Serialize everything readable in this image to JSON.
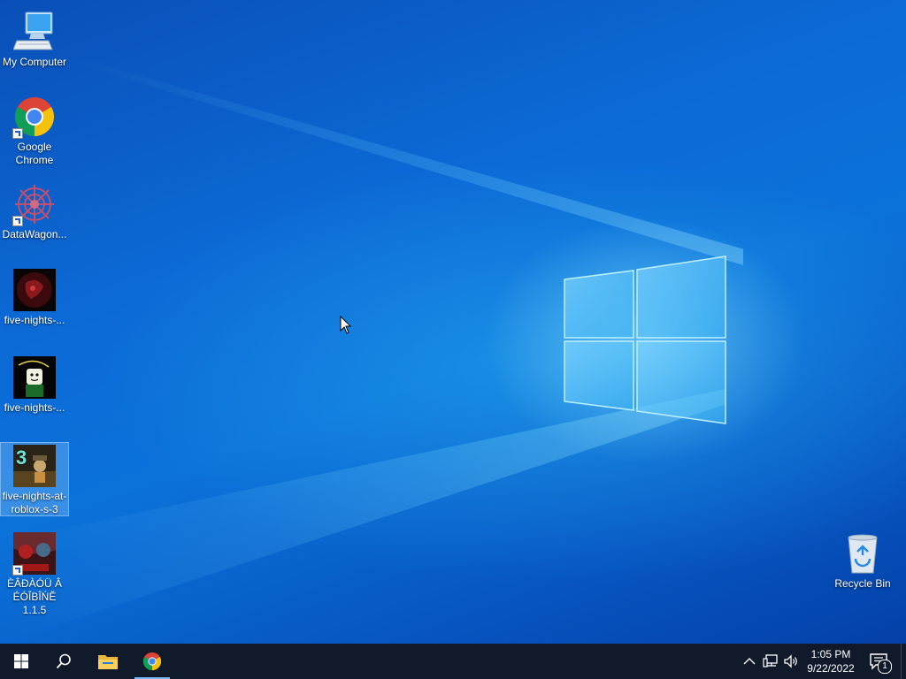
{
  "desktop": {
    "icons": [
      {
        "label": "My Computer"
      },
      {
        "label": "Google Chrome"
      },
      {
        "label": "DataWagon..."
      },
      {
        "label": "five-nights-..."
      },
      {
        "label": "five-nights-..."
      },
      {
        "label": "five-nights-at-roblox-s-3"
      },
      {
        "label": "ÈÂÐÀÓÜ Â ÉÓÎBÎŃĚ 1.1.5"
      }
    ],
    "recycle_bin": {
      "label": "Recycle Bin"
    }
  },
  "taskbar": {
    "buttons": [
      "start-button",
      "search-button",
      "file-explorer-button",
      "chrome-button"
    ],
    "clock": {
      "time": "1:05 PM",
      "date": "9/22/2022"
    },
    "notification_count": "1"
  },
  "colors": {
    "taskbar_bg": "#101a2a",
    "desktop_blue": "#0b6fd8",
    "accent": "#7ab8ff"
  }
}
